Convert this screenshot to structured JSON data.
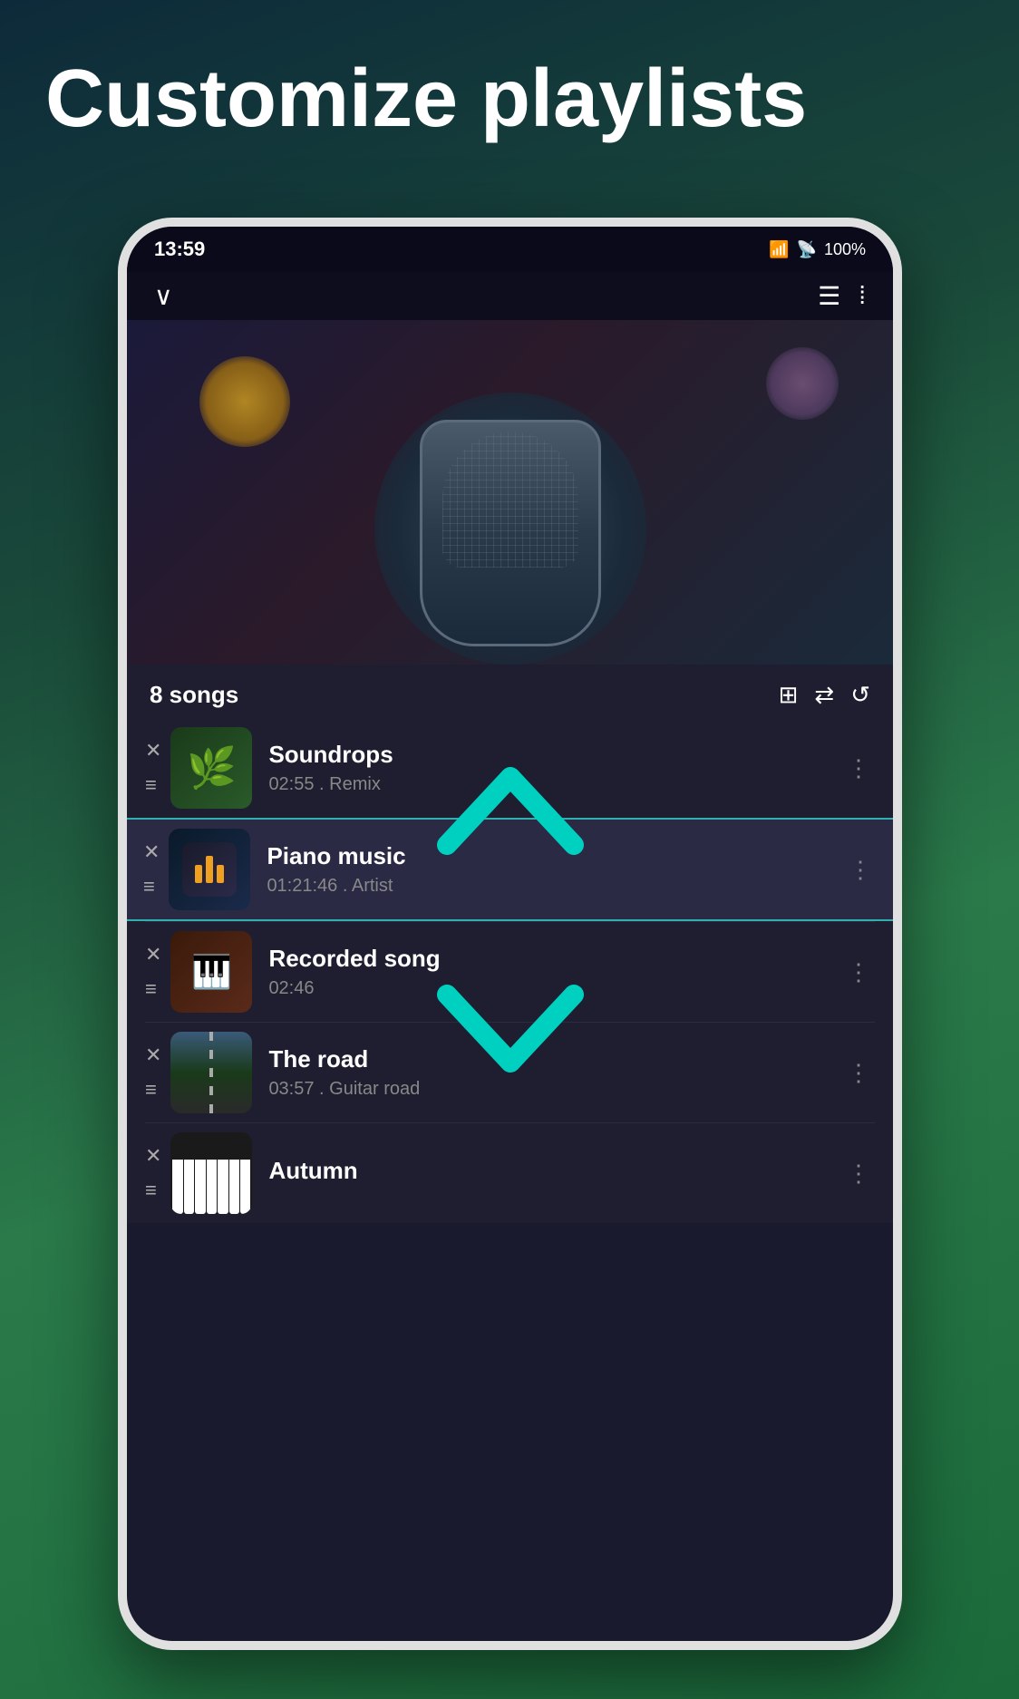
{
  "page": {
    "title": "Customize playlists",
    "background_gradient": [
      "#0d2a3a",
      "#1a4a3a",
      "#2a7a4a"
    ]
  },
  "status_bar": {
    "time": "13:59",
    "wifi": "WiFi",
    "signal": "Signal",
    "battery": "100%"
  },
  "playlist_header": {
    "songs_count": "8 songs"
  },
  "controls": {
    "add_icon": "⊞",
    "shuffle_icon": "⇄",
    "repeat_icon": "↺"
  },
  "songs": [
    {
      "title": "Soundrops",
      "duration": "02:55",
      "artist": "Remix",
      "thumb_type": "nature"
    },
    {
      "title": "Piano music",
      "duration": "01:21:46",
      "artist": "Artist",
      "thumb_type": "piano",
      "highlighted": true
    },
    {
      "title": "Recorded song",
      "duration": "02:46",
      "artist": "",
      "thumb_type": "recorded"
    },
    {
      "title": "The road",
      "duration": "03:57",
      "artist": "Guitar road",
      "thumb_type": "road"
    },
    {
      "title": "Autumn",
      "duration": "",
      "artist": "",
      "thumb_type": "keyboard"
    }
  ],
  "nav": {
    "back_icon": "∨",
    "menu_icon": "☰",
    "more_icon": "⁞"
  }
}
